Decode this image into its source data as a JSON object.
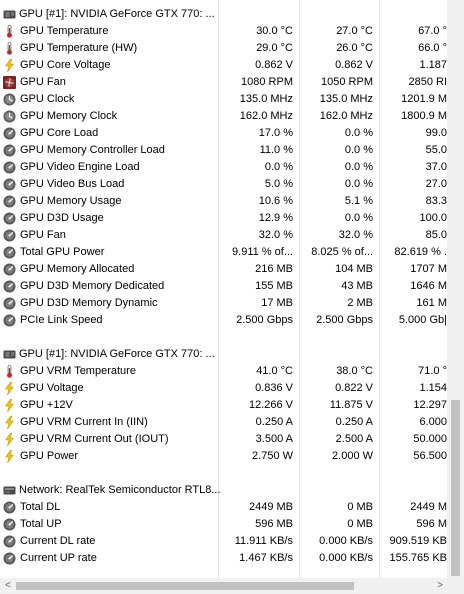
{
  "colors": {
    "gridline": "#e4e4e4",
    "scroll_thumb": "#c1c1c1",
    "scroll_track": "#f0f0f0"
  },
  "sections": [
    {
      "header": "GPU [#1]: NVIDIA GeForce GTX 770: ...",
      "icon": "gpu-chip-icon",
      "rows": [
        {
          "icon": "thermometer-icon",
          "label": "GPU Temperature",
          "current": "30.0 °C",
          "min": "27.0 °C",
          "max": "67.0 °"
        },
        {
          "icon": "thermometer-icon",
          "label": "GPU Temperature (HW)",
          "current": "29.0 °C",
          "min": "26.0 °C",
          "max": "66.0 °"
        },
        {
          "icon": "lightning-icon",
          "label": "GPU Core Voltage",
          "current": "0.862 V",
          "min": "0.862 V",
          "max": "1.187"
        },
        {
          "icon": "fan-icon",
          "label": "GPU Fan",
          "current": "1080 RPM",
          "min": "1050 RPM",
          "max": "2850 RI"
        },
        {
          "icon": "clock-icon",
          "label": "GPU Clock",
          "current": "135.0 MHz",
          "min": "135.0 MHz",
          "max": "1201.9 M"
        },
        {
          "icon": "clock-icon",
          "label": "GPU Memory Clock",
          "current": "162.0 MHz",
          "min": "162.0 MHz",
          "max": "1800.9 M"
        },
        {
          "icon": "gauge-icon",
          "label": "GPU Core Load",
          "current": "17.0 %",
          "min": "0.0 %",
          "max": "99.0"
        },
        {
          "icon": "gauge-icon",
          "label": "GPU Memory Controller Load",
          "current": "11.0 %",
          "min": "0.0 %",
          "max": "55.0"
        },
        {
          "icon": "gauge-icon",
          "label": "GPU Video Engine Load",
          "current": "0.0 %",
          "min": "0.0 %",
          "max": "37.0"
        },
        {
          "icon": "gauge-icon",
          "label": "GPU Video Bus Load",
          "current": "5.0 %",
          "min": "0.0 %",
          "max": "27.0"
        },
        {
          "icon": "gauge-icon",
          "label": "GPU Memory Usage",
          "current": "10.6 %",
          "min": "5.1 %",
          "max": "83.3"
        },
        {
          "icon": "gauge-icon",
          "label": "GPU D3D Usage",
          "current": "12.9 %",
          "min": "0.0 %",
          "max": "100.0"
        },
        {
          "icon": "gauge-icon",
          "label": "GPU Fan",
          "current": "32.0 %",
          "min": "32.0 %",
          "max": "85.0"
        },
        {
          "icon": "gauge-icon",
          "label": "Total GPU Power",
          "current": "9.911 % of...",
          "min": "8.025 % of...",
          "max": "82.619 % ."
        },
        {
          "icon": "gauge-icon",
          "label": "GPU Memory Allocated",
          "current": "216 MB",
          "min": "104 MB",
          "max": "1707 M"
        },
        {
          "icon": "gauge-icon",
          "label": "GPU D3D Memory Dedicated",
          "current": "155 MB",
          "min": "43 MB",
          "max": "1646 M"
        },
        {
          "icon": "gauge-icon",
          "label": "GPU D3D Memory Dynamic",
          "current": "17 MB",
          "min": "2 MB",
          "max": "161 M"
        },
        {
          "icon": "gauge-icon",
          "label": "PCIe Link Speed",
          "current": "2.500 Gbps",
          "min": "2.500 Gbps",
          "max": "5.000 Gb|"
        }
      ]
    },
    {
      "header": "GPU [#1]: NVIDIA GeForce GTX 770: ...",
      "icon": "gpu-chip-icon",
      "rows": [
        {
          "icon": "thermometer-icon",
          "label": "GPU VRM Temperature",
          "current": "41.0 °C",
          "min": "38.0 °C",
          "max": "71.0 °"
        },
        {
          "icon": "lightning-icon",
          "label": "GPU Voltage",
          "current": "0.836 V",
          "min": "0.822 V",
          "max": "1.154"
        },
        {
          "icon": "lightning-icon",
          "label": "GPU +12V",
          "current": "12.266 V",
          "min": "11.875 V",
          "max": "12.297"
        },
        {
          "icon": "lightning-icon",
          "label": "GPU VRM Current In (IIN)",
          "current": "0.250 A",
          "min": "0.250 A",
          "max": "6.000"
        },
        {
          "icon": "lightning-icon",
          "label": "GPU VRM Current Out (IOUT)",
          "current": "3.500 A",
          "min": "2.500 A",
          "max": "50.000"
        },
        {
          "icon": "lightning-icon",
          "label": "GPU Power",
          "current": "2.750 W",
          "min": "2.000 W",
          "max": "56.500"
        }
      ]
    },
    {
      "header": "Network: RealTek Semiconductor RTL8...",
      "icon": "network-icon",
      "rows": [
        {
          "icon": "gauge-icon",
          "label": "Total DL",
          "current": "2449 MB",
          "min": "0 MB",
          "max": "2449 M"
        },
        {
          "icon": "gauge-icon",
          "label": "Total UP",
          "current": "596 MB",
          "min": "0 MB",
          "max": "596 M"
        },
        {
          "icon": "gauge-icon",
          "label": "Current DL rate",
          "current": "11.911 KB/s",
          "min": "0.000 KB/s",
          "max": "909.519 KB"
        },
        {
          "icon": "gauge-icon",
          "label": "Current UP rate",
          "current": "1.467 KB/s",
          "min": "0.000 KB/s",
          "max": "155.765 KB"
        }
      ]
    }
  ],
  "scrollbars": {
    "left_arrow": "<",
    "right_arrow": ">"
  }
}
